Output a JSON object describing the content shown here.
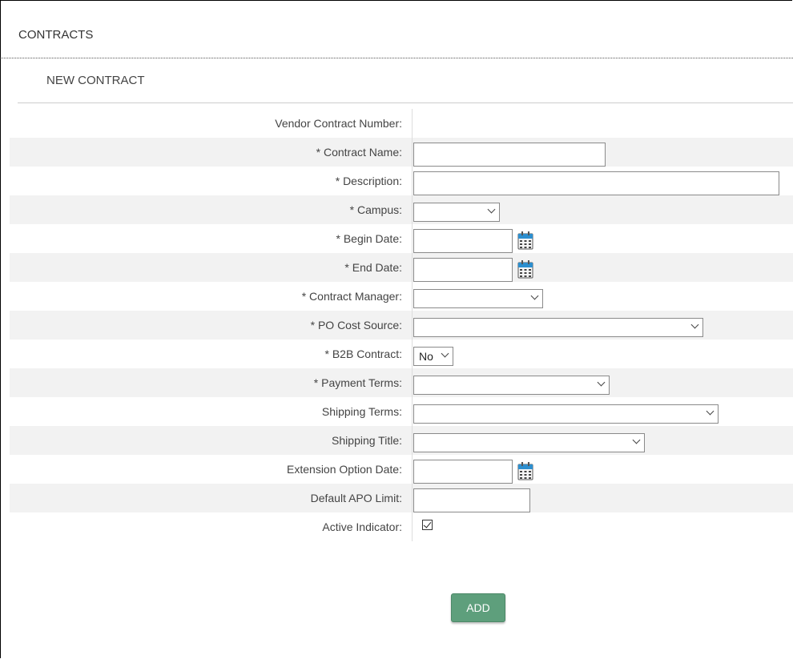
{
  "header": {
    "title": "CONTRACTS"
  },
  "section": {
    "title": "NEW CONTRACT"
  },
  "colors": {
    "accent_button": "#5e9f7c",
    "row_shade": "#f2f2f2"
  },
  "form": {
    "rows": [
      {
        "label": "Vendor Contract Number:"
      },
      {
        "label": "* Contract Name:",
        "value": ""
      },
      {
        "label": "* Description:",
        "value": ""
      },
      {
        "label": "* Campus:",
        "value": ""
      },
      {
        "label": "* Begin Date:",
        "value": "",
        "icon": "calendar-icon"
      },
      {
        "label": "* End Date:",
        "value": "",
        "icon": "calendar-icon"
      },
      {
        "label": "* Contract Manager:",
        "value": ""
      },
      {
        "label": "* PO Cost Source:",
        "value": ""
      },
      {
        "label": "* B2B Contract:",
        "value": "No"
      },
      {
        "label": "* Payment Terms:",
        "value": ""
      },
      {
        "label": "Shipping Terms:",
        "value": ""
      },
      {
        "label": "Shipping Title:",
        "value": ""
      },
      {
        "label": "Extension Option Date:",
        "value": "",
        "icon": "calendar-icon"
      },
      {
        "label": "Default APO Limit:",
        "value": ""
      },
      {
        "label": "Active Indicator:",
        "checked": true
      }
    ],
    "submit_label": "ADD"
  }
}
